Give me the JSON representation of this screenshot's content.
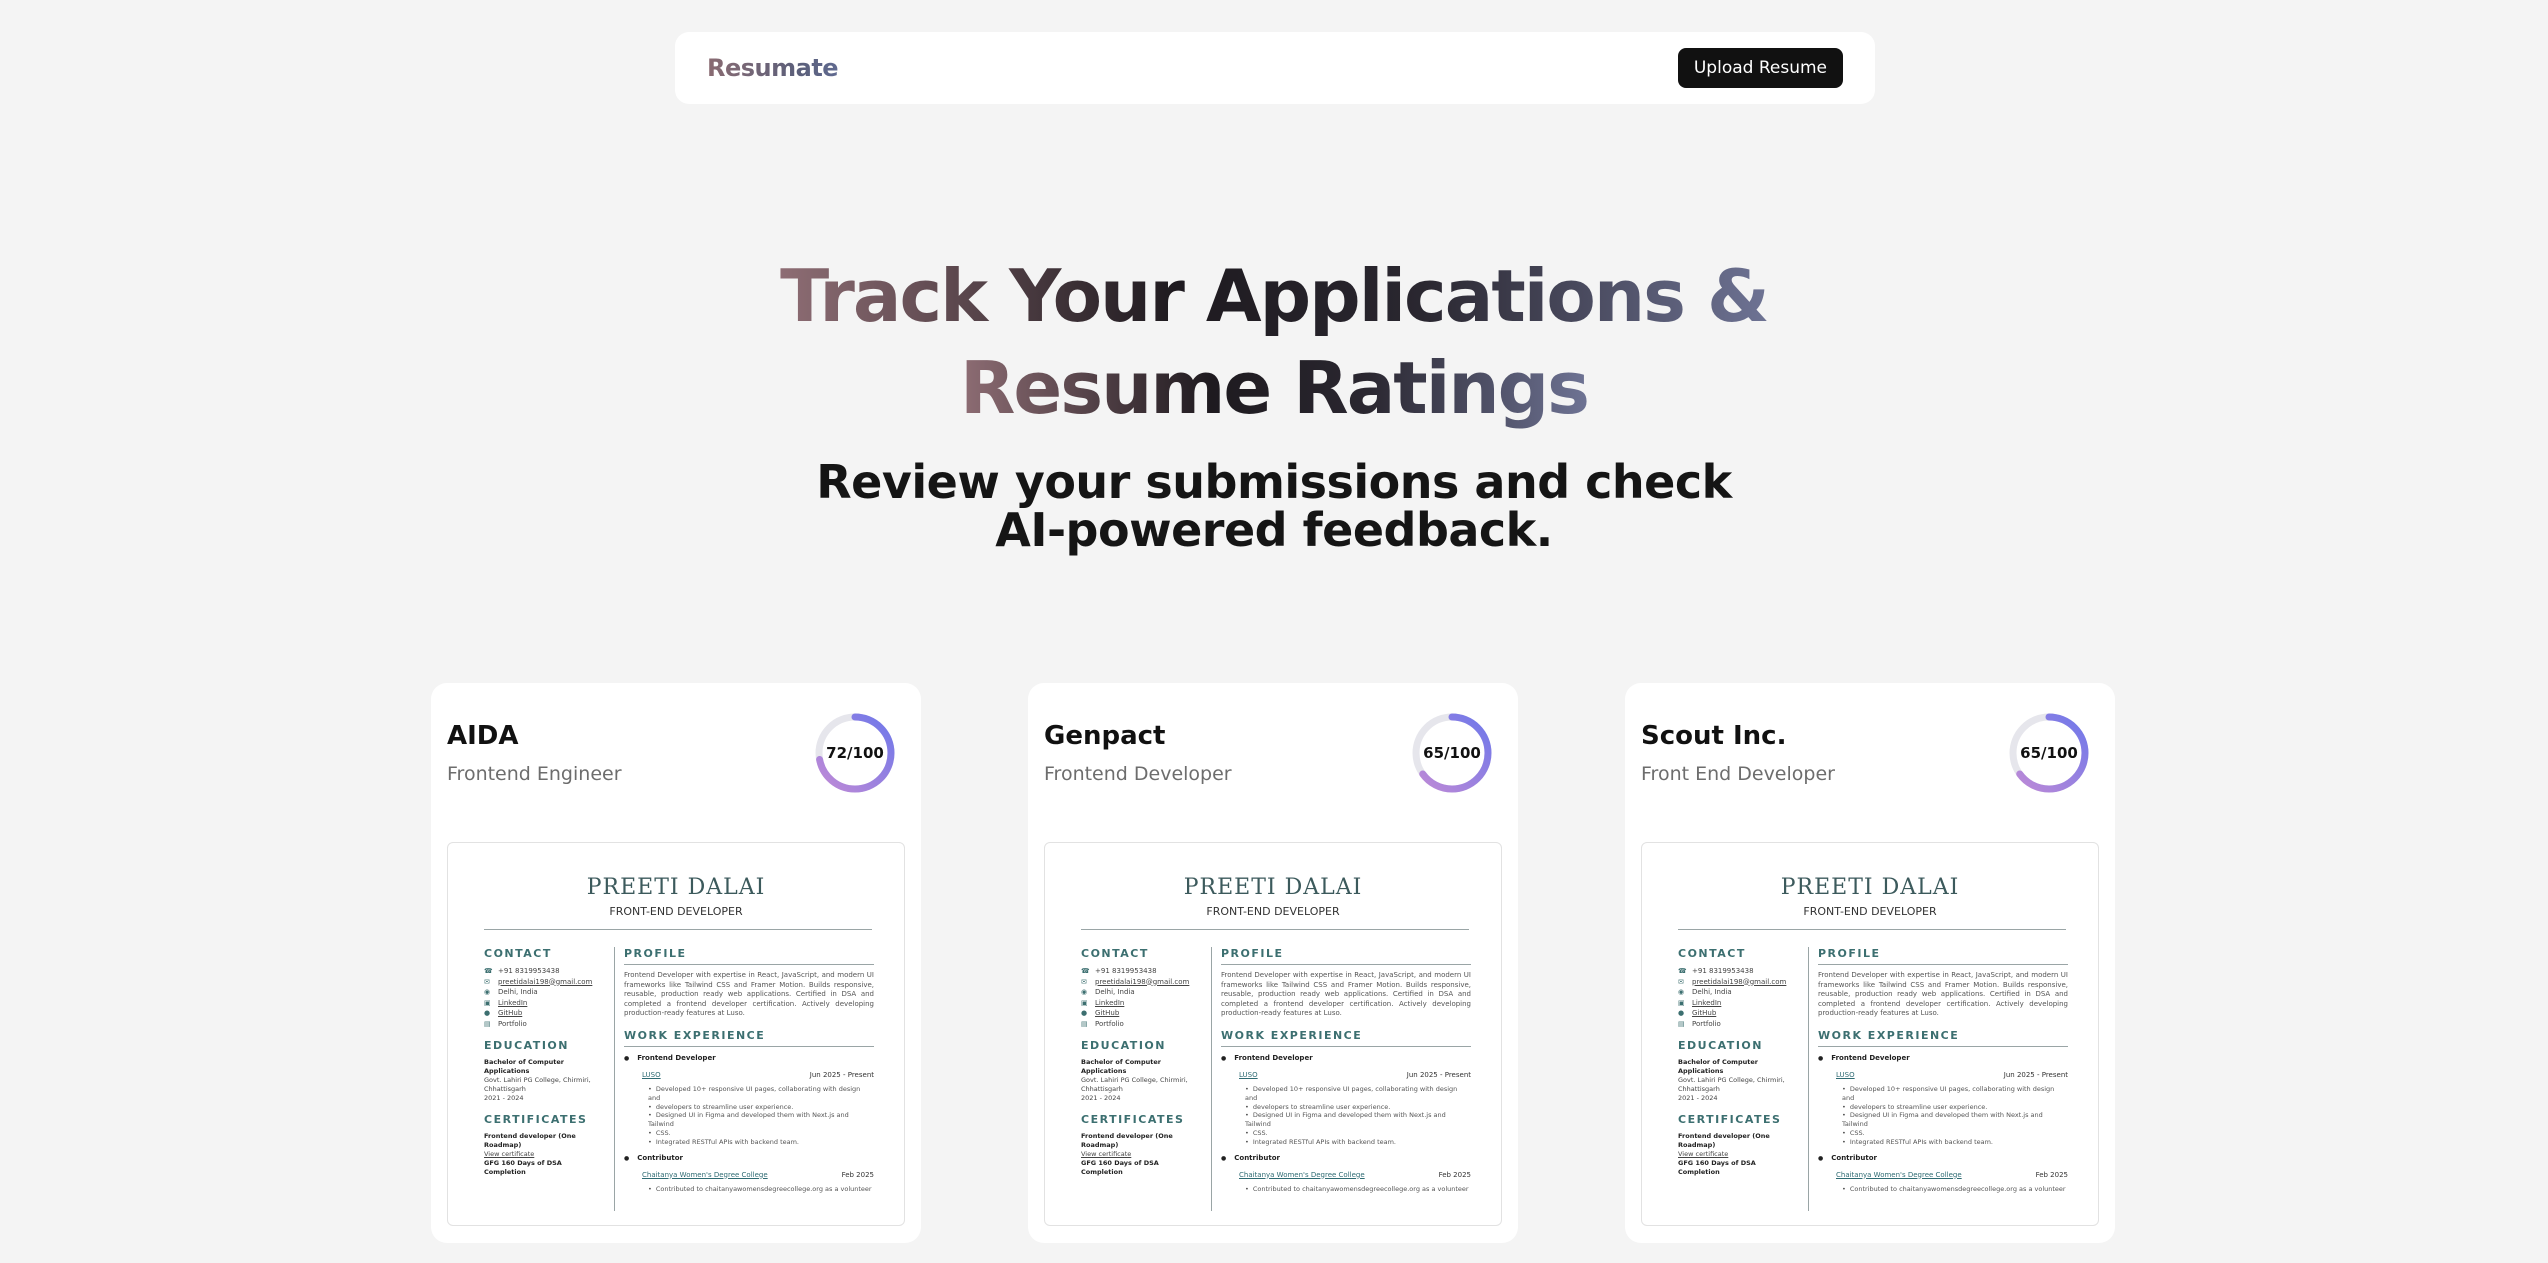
{
  "nav": {
    "logo": "Resumate",
    "upload_label": "Upload Resume"
  },
  "hero": {
    "title_line1": "Track Your Applications &",
    "title_line2": "Resume Ratings",
    "subtitle_line1": "Review your submissions and check",
    "subtitle_line2": "AI-powered feedback."
  },
  "colors": {
    "background": "#f4f4f4",
    "button": "#111111",
    "score_gradient_start": "#c08ad6",
    "score_gradient_end": "#6f78ea",
    "score_track": "#e6e6ec",
    "resume_accent": "#3c6f70"
  },
  "cards": [
    {
      "company": "AIDA",
      "role": "Frontend Engineer",
      "score_text": "72/100",
      "score": 72
    },
    {
      "company": "Genpact",
      "role": "Frontend Developer",
      "score_text": "65/100",
      "score": 65
    },
    {
      "company": "Scout Inc.",
      "role": "Front End Developer",
      "score_text": "65/100",
      "score": 65
    }
  ],
  "resume": {
    "name": "PREETI DALAI",
    "title": "FRONT-END DEVELOPER",
    "contact_heading": "CONTACT",
    "contact": [
      {
        "icon": "phone-icon",
        "glyph": "☎",
        "text": "+91 8319953438"
      },
      {
        "icon": "mail-icon",
        "glyph": "✉",
        "text": "preetidalai198@gmail.com"
      },
      {
        "icon": "location-icon",
        "glyph": "◉",
        "text": "Delhi, India"
      },
      {
        "icon": "linkedin-icon",
        "glyph": "▣",
        "text": "LinkedIn"
      },
      {
        "icon": "github-icon",
        "glyph": "●",
        "text": "GitHub"
      },
      {
        "icon": "portfolio-icon",
        "glyph": "▤",
        "text": "Portfolio"
      }
    ],
    "education_heading": "EDUCATION",
    "education": [
      "Bachelor of Computer Applications",
      "Govt. Lahiri PG College, Chirmiri,",
      "Chhattisgarh",
      "2021 - 2024"
    ],
    "certificates_heading": "CERTIFICATES",
    "certificates": [
      "Frontend developer (One Roadmap)",
      "View certificate",
      "GFG 160 Days of DSA Completion"
    ],
    "profile_heading": "PROFILE",
    "profile": "Frontend Developer with expertise in React, JavaScript, and modern UI frameworks like Tailwind CSS and Framer Motion. Builds responsive, reusable, production ready web applications. Certified in DSA and completed a frontend developer certification. Actively developing production-ready features at Luso.",
    "work_heading": "WORK EXPERIENCE",
    "jobs": [
      {
        "role": "Frontend Developer",
        "company": "LUSO",
        "date": "Jun 2025 - Present",
        "bullets": [
          "Developed 10+ responsive UI pages, collaborating with design and",
          "developers to streamline user experience.",
          "Designed UI in Figma and developed them with Next.js and Tailwind",
          "CSS.",
          "Integrated RESTful APIs with backend team."
        ]
      },
      {
        "role": "Contributor",
        "company": "Chaitanya Women's Degree College",
        "date": "Feb 2025",
        "bullets": [
          "Contributed to chaitanyawomensdegreecollege.org as a volunteer"
        ]
      }
    ]
  }
}
